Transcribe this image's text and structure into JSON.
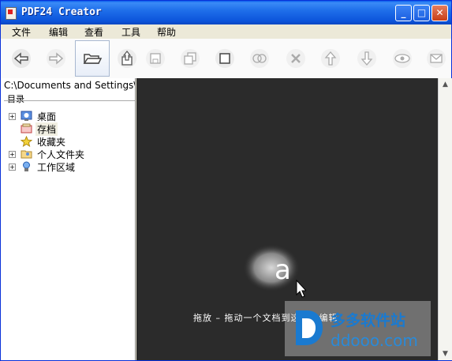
{
  "window": {
    "title": "PDF24 Creator",
    "min_symbol": "_",
    "max_symbol": "□",
    "close_symbol": "✕"
  },
  "menu": [
    "文件",
    "编辑",
    "查看",
    "工具",
    "帮助"
  ],
  "toolbar": {
    "buttons": [
      {
        "name": "back-button",
        "icon": "arrow-left-icon"
      },
      {
        "name": "forward-button",
        "icon": "arrow-right-icon"
      },
      {
        "name": "open-button",
        "icon": "folder-open-icon"
      },
      {
        "name": "import-button",
        "icon": "import-icon"
      },
      {
        "name": "save-button",
        "icon": "save-icon"
      },
      {
        "name": "copy-button",
        "icon": "copy-icon"
      },
      {
        "name": "single-page-button",
        "icon": "square-icon"
      },
      {
        "name": "merge-button",
        "icon": "merge-icon"
      },
      {
        "name": "delete-button",
        "icon": "delete-icon"
      },
      {
        "name": "move-up-button",
        "icon": "arrow-up-icon"
      },
      {
        "name": "move-down-button",
        "icon": "arrow-down-icon"
      },
      {
        "name": "preview-button",
        "icon": "eye-icon"
      },
      {
        "name": "email-button",
        "icon": "email-icon"
      }
    ]
  },
  "sidebar": {
    "path": "C:\\Documents and Settings\\",
    "tree_header": "目录",
    "items": [
      {
        "label": "桌面",
        "expandable": true,
        "icon": "desktop-icon"
      },
      {
        "label": "存档",
        "expandable": false,
        "icon": "archive-icon",
        "selected": true
      },
      {
        "label": "收藏夹",
        "expandable": false,
        "icon": "favorites-icon"
      },
      {
        "label": "个人文件夹",
        "expandable": true,
        "icon": "personal-folder-icon"
      },
      {
        "label": "工作区域",
        "expandable": true,
        "icon": "workspace-icon"
      }
    ]
  },
  "canvas": {
    "drop_hint": "拖放 – 拖动一个文档到这里来编辑",
    "logo_letter": "a"
  },
  "watermark": {
    "brand": "多多软件站",
    "url": "ddooo.com",
    "logo_letter": "D"
  }
}
